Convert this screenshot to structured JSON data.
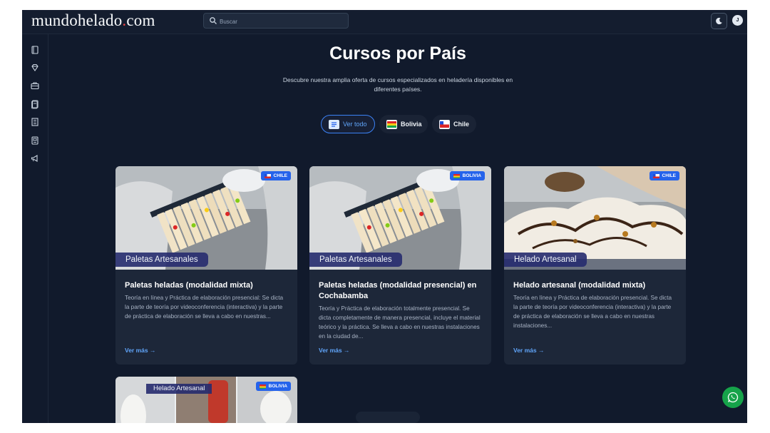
{
  "header": {
    "logo": "mundohelado",
    "logo_dot": ".",
    "logo_tld": "com",
    "search_placeholder": "Buscar",
    "avatar_initial": "J"
  },
  "sidebar": {
    "items": [
      "book-icon",
      "gem-icon",
      "briefcase-icon",
      "document-icon",
      "building-icon",
      "catalog-icon",
      "megaphone-icon"
    ]
  },
  "page": {
    "title": "Cursos por País",
    "subtitle": "Descubre nuestra amplia oferta de cursos especializados en heladería disponibles en diferentes países."
  },
  "filters": [
    {
      "label": "Ver todo",
      "icon": "list-icon",
      "active": true
    },
    {
      "label": "Bolivia",
      "icon": "bolivia-flag-icon",
      "active": false
    },
    {
      "label": "Chile",
      "icon": "chile-flag-icon",
      "active": false
    }
  ],
  "courses": [
    {
      "category": "Paletas Artesanales",
      "country": "CHILE",
      "title": "Paletas heladas (modalidad mixta)",
      "description": "Teoría en línea y Práctica de elaboración presencial: Se dicta la parte de teoría por videoconferencia (interactiva) y la parte de práctica de elaboración se lleva a cabo en nuestras...",
      "link": "Ver más →"
    },
    {
      "category": "Paletas Artesanales",
      "country": "BOLIVIA",
      "title": "Paletas heladas (modalidad presencial) en Cochabamba",
      "description": "Teoría y Práctica de elaboración totalmente presencial. Se dicta completamente de manera presencial, incluye el material teórico y la práctica. Se lleva a cabo en nuestras instalaciones en la ciudad de...",
      "link": "Ver más →"
    },
    {
      "category": "Helado Artesanal",
      "country": "CHILE",
      "title": "Helado artesanal (modalidad mixta)",
      "description": "Teoría en línea y Práctica de elaboración presencial. Se dicta la parte de teoría por videoconferencia (interactiva) y la parte de práctica de elaboración se lleva a cabo en nuestras instalaciones...",
      "link": "Ver más →"
    },
    {
      "category": "Helado Artesanal",
      "country": "BOLIVIA"
    }
  ],
  "colors": {
    "background": "#111a2c",
    "card": "#1d2739",
    "accent": "#3b82f6",
    "link": "#60a5fa",
    "whatsapp": "#16a34a"
  }
}
